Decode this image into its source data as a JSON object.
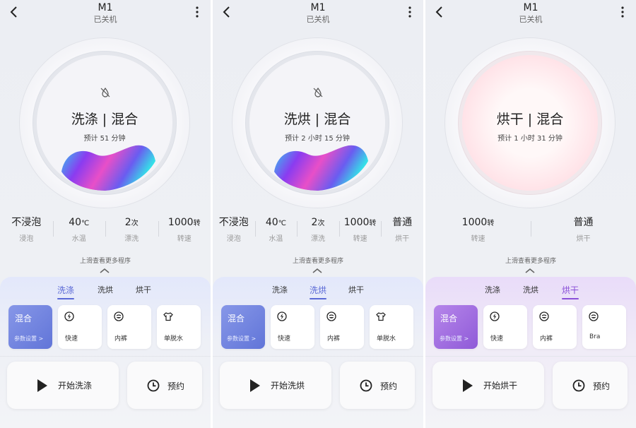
{
  "panels": [
    {
      "header": {
        "title": "M1",
        "status": "已关机"
      },
      "dial": {
        "mode": "洗涤  |  混合",
        "estimate": "预计 51 分钟"
      },
      "stats": [
        {
          "value": "不浸泡",
          "unit": "",
          "label": "浸泡"
        },
        {
          "value": "40",
          "unit": "℃",
          "label": "水温"
        },
        {
          "value": "2",
          "unit": "次",
          "label": "漂洗"
        },
        {
          "value": "1000",
          "unit": "转",
          "label": "转速"
        }
      ],
      "hint": "上滑查看更多程序",
      "tabs": [
        "洗涤",
        "洗烘",
        "烘干"
      ],
      "active_tab": "洗涤",
      "programs": {
        "selected_title": "混合",
        "selected_sub": "参数设置 >",
        "others": [
          "快速",
          "内裤",
          "单脱水"
        ]
      },
      "actions": {
        "start": "开始洗涤",
        "schedule": "预约"
      }
    },
    {
      "header": {
        "title": "M1",
        "status": "已关机"
      },
      "dial": {
        "mode": "洗烘  |  混合",
        "estimate": "预计 2 小时 15 分钟"
      },
      "stats": [
        {
          "value": "不浸泡",
          "unit": "",
          "label": "浸泡"
        },
        {
          "value": "40",
          "unit": "℃",
          "label": "水温"
        },
        {
          "value": "2",
          "unit": "次",
          "label": "漂洗"
        },
        {
          "value": "1000",
          "unit": "转",
          "label": "转速"
        },
        {
          "value": "普通",
          "unit": "",
          "label": "烘干"
        }
      ],
      "hint": "上滑查看更多程序",
      "tabs": [
        "洗涤",
        "洗烘",
        "烘干"
      ],
      "active_tab": "洗烘",
      "programs": {
        "selected_title": "混合",
        "selected_sub": "参数设置 >",
        "others": [
          "快速",
          "内裤",
          "单脱水"
        ]
      },
      "actions": {
        "start": "开始洗烘",
        "schedule": "预约"
      }
    },
    {
      "header": {
        "title": "M1",
        "status": "已关机"
      },
      "dial": {
        "mode": "烘干  |  混合",
        "estimate": "预计 1 小时 31 分钟"
      },
      "stats": [
        {
          "value": "1000",
          "unit": "转",
          "label": "转速"
        },
        {
          "value": "普通",
          "unit": "",
          "label": "烘干"
        }
      ],
      "hint": "上滑查看更多程序",
      "tabs": [
        "洗涤",
        "洗烘",
        "烘干"
      ],
      "active_tab": "烘干",
      "programs": {
        "selected_title": "混合",
        "selected_sub": "参数设置 >",
        "others": [
          "快速",
          "内裤",
          "Bra"
        ]
      },
      "actions": {
        "start": "开始烘干",
        "schedule": "预约"
      }
    }
  ],
  "colors": {
    "wash_accent": "#5a69d6",
    "dry_accent": "#8a4fd8",
    "selected_card_wash": "#6f82df",
    "selected_card_dry": "#a36fe2"
  },
  "icons": [
    "back-arrow-icon",
    "more-dots-icon",
    "no-foam-icon",
    "chevron-up-icon",
    "lightning-icon",
    "face-icon",
    "shirt-icon",
    "play-icon",
    "clock-icon"
  ]
}
